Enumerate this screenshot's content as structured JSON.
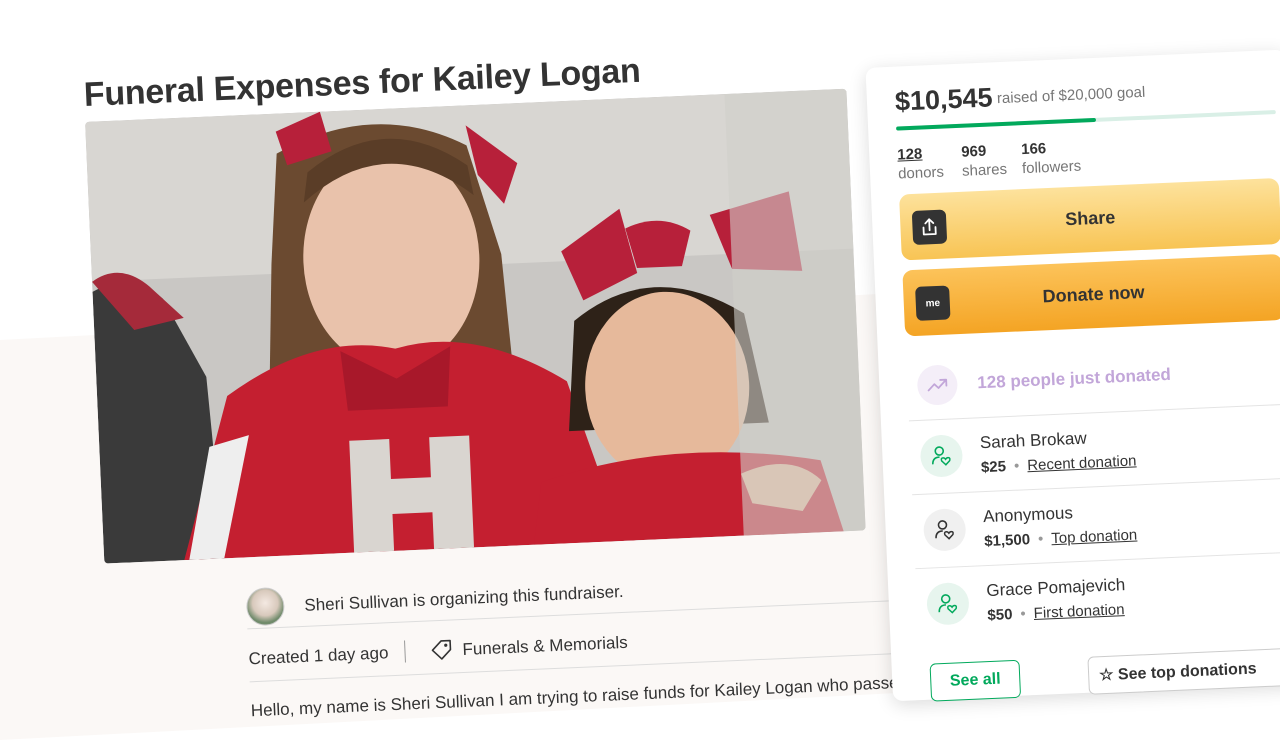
{
  "campaign": {
    "title": "Funeral Expenses for Kailey Logan",
    "organizer_text": "Sheri Sullivan is organizing this fundraiser.",
    "created": "Created 1 day ago",
    "category": "Funerals & Memorials",
    "story_preview": "Hello, my name is Sheri Sullivan I am trying to raise funds for Kailey Logan who passed"
  },
  "donation_card": {
    "amount_raised": "$10,545",
    "goal_text": "raised of $20,000 goal",
    "progress_fraction": 0.527,
    "stats": [
      {
        "value": "128",
        "label": "donors"
      },
      {
        "value": "969",
        "label": "shares"
      },
      {
        "value": "166",
        "label": "followers"
      }
    ],
    "share_label": "Share",
    "donate_label": "Donate now",
    "donate_icon_text": "me",
    "trend_text": "128 people just donated",
    "donations": [
      {
        "name": "Sarah Brokaw",
        "amount": "$25",
        "badge": "Recent donation"
      },
      {
        "name": "Anonymous",
        "amount": "$1,500",
        "badge": "Top donation"
      },
      {
        "name": "Grace Pomajevich",
        "amount": "$50",
        "badge": "First donation"
      }
    ],
    "see_all_label": "See all",
    "see_top_label": "See top donations"
  },
  "colors": {
    "green": "#02a95c",
    "share_yellow": "#f8c454",
    "donate_orange": "#f4a424",
    "trend_purple": "#c2a6d9"
  }
}
